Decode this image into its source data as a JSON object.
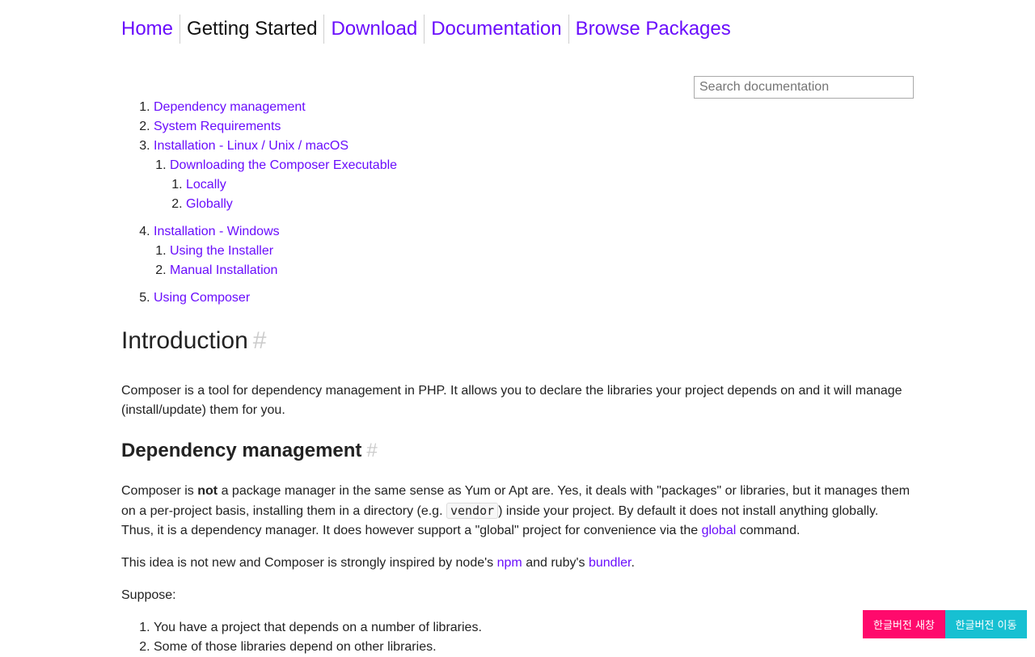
{
  "nav": {
    "items": [
      {
        "label": "Home",
        "active": false
      },
      {
        "label": "Getting Started",
        "active": true
      },
      {
        "label": "Download",
        "active": false
      },
      {
        "label": "Documentation",
        "active": false
      },
      {
        "label": "Browse Packages",
        "active": false
      }
    ]
  },
  "search": {
    "placeholder": "Search documentation",
    "value": ""
  },
  "toc": {
    "items": [
      {
        "label": "Dependency management"
      },
      {
        "label": "System Requirements"
      },
      {
        "label": "Installation - Linux / Unix / macOS",
        "sub": [
          {
            "label": "Downloading the Composer Executable",
            "sub": [
              {
                "label": "Locally"
              },
              {
                "label": "Globally"
              }
            ]
          }
        ]
      },
      {
        "label": "Installation - Windows",
        "sub": [
          {
            "label": "Using the Installer"
          },
          {
            "label": "Manual Installation"
          }
        ]
      },
      {
        "label": "Using Composer"
      }
    ]
  },
  "content": {
    "intro_heading": "Introduction",
    "anchor_symbol": "#",
    "intro_text": "Composer is a tool for dependency management in PHP. It allows you to declare the libraries your project depends on and it will manage (install/update) them for you.",
    "dep_heading": "Dependency management",
    "dep_p1_before_bold": "Composer is ",
    "dep_p1_bold": "not",
    "dep_p1_after_bold": " a package manager in the same sense as Yum or Apt are. Yes, it deals with \"packages\" or libraries, but it manages them on a per-project basis, installing them in a directory (e.g. ",
    "dep_p1_code": "vendor",
    "dep_p1_after_code": ") inside your project. By default it does not install anything globally. Thus, it is a dependency manager. It does however support a \"global\" project for convenience via the ",
    "dep_p1_link": "global",
    "dep_p1_end": " command.",
    "idea_before": "This idea is not new and Composer is strongly inspired by node's ",
    "idea_link1": "npm",
    "idea_mid": " and ruby's ",
    "idea_link2": "bundler",
    "idea_end": ".",
    "suppose": "Suppose:",
    "suppose_items": [
      "You have a project that depends on a number of libraries.",
      "Some of those libraries depend on other libraries."
    ]
  },
  "korean_buttons": {
    "new_window": "한글버전 새창",
    "move": "한글버전 이동"
  },
  "colors": {
    "link": "#6a0dfc",
    "btn_new": "#ff0a6c",
    "btn_move": "#17c0d2"
  }
}
